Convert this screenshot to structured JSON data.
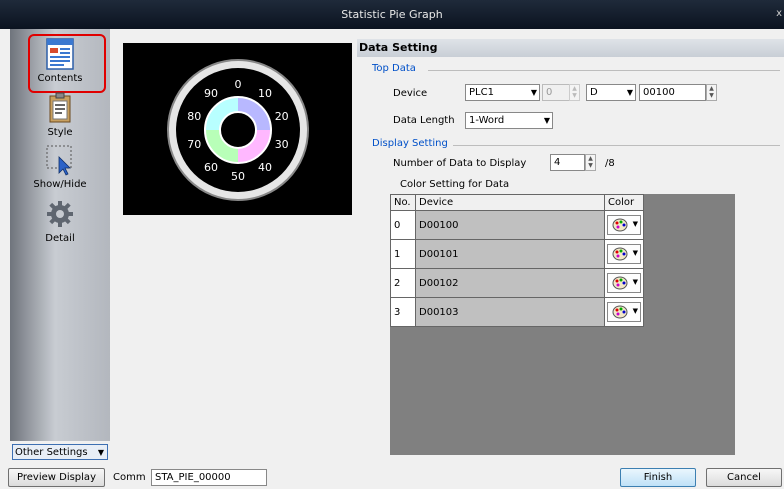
{
  "window": {
    "title": "Statistic Pie Graph",
    "close_glyph": "x"
  },
  "sidebar": {
    "items": [
      {
        "label": "Contents",
        "icon": "contents-icon"
      },
      {
        "label": "Style",
        "icon": "style-icon"
      },
      {
        "label": "Show/Hide",
        "icon": "show-hide-icon"
      },
      {
        "label": "Detail",
        "icon": "detail-icon"
      }
    ],
    "other_settings": "Other Settings"
  },
  "preview": {
    "scale_labels": [
      "0",
      "10",
      "20",
      "30",
      "40",
      "50",
      "60",
      "70",
      "80",
      "90"
    ],
    "segment_colors": [
      "#b8b8ff",
      "#ffb8ff",
      "#b8ffb8",
      "#b8ffff"
    ]
  },
  "data_setting": {
    "header": "Data Setting",
    "top_data": {
      "section_label": "Top Data",
      "device_label": "Device",
      "plc_value": "PLC1",
      "station_value": "0",
      "type_value": "D",
      "address_value": "00100",
      "data_length_label": "Data Length",
      "data_length_value": "1-Word"
    },
    "display_setting": {
      "section_label": "Display Setting",
      "num_data_label": "Number of Data to Display",
      "num_data_value": "4",
      "num_data_max": "/8",
      "color_setting_label": "Color Setting for Data"
    },
    "table": {
      "headers": [
        "No.",
        "Device",
        "Color"
      ],
      "rows": [
        {
          "no": "0",
          "device": "D00100"
        },
        {
          "no": "1",
          "device": "D00101"
        },
        {
          "no": "2",
          "device": "D00102"
        },
        {
          "no": "3",
          "device": "D00103"
        }
      ]
    }
  },
  "bottom": {
    "preview_button": "Preview Display",
    "comm_label": "Comm",
    "comm_value": "STA_PIE_00000",
    "finish_button": "Finish",
    "cancel_button": "Cancel"
  }
}
